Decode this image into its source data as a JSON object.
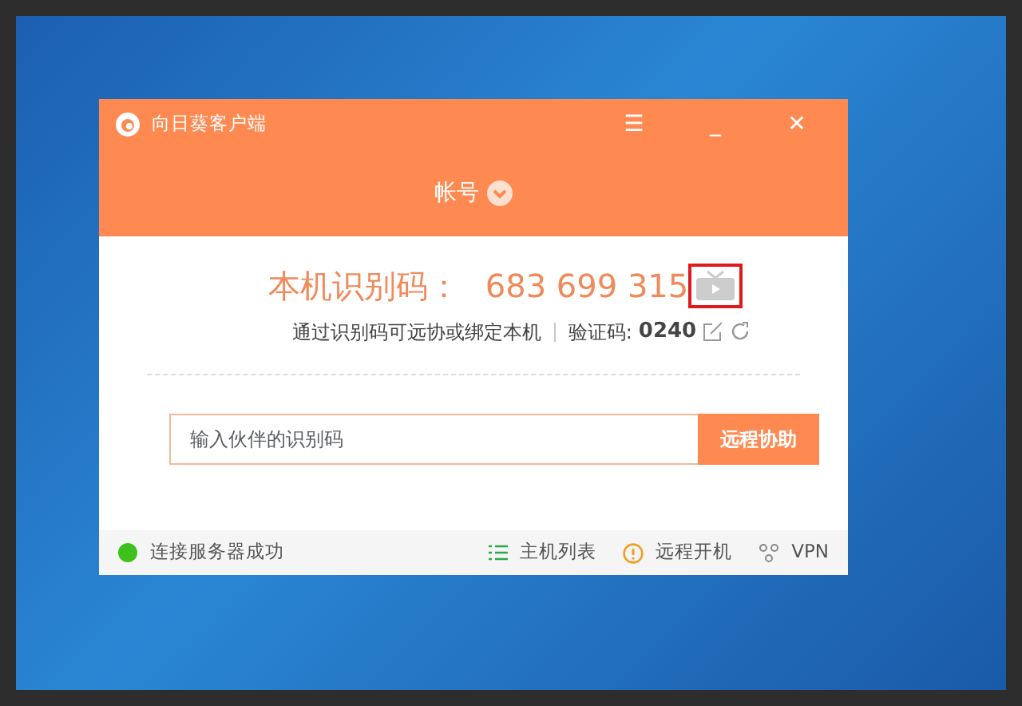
{
  "window": {
    "title": "向日葵客户端",
    "menu_glyph": "☰",
    "minimize_glyph": "_",
    "close_glyph": "✕"
  },
  "account": {
    "label": "帐号"
  },
  "identity": {
    "label": "本机识别码：",
    "code": "683 699 315",
    "video_highlighted": true,
    "hint": "通过识别码可远协或绑定本机",
    "verify_label": "验证码:",
    "verify_code": "0240"
  },
  "connect": {
    "placeholder": "输入伙伴的识别码",
    "button": "远程协助"
  },
  "status_bar": {
    "connected": true,
    "status": "连接服务器成功",
    "links": [
      {
        "kind": "list",
        "label": "主机列表"
      },
      {
        "kind": "power",
        "label": "远程开机"
      },
      {
        "kind": "vpn",
        "label": "VPN"
      }
    ]
  }
}
